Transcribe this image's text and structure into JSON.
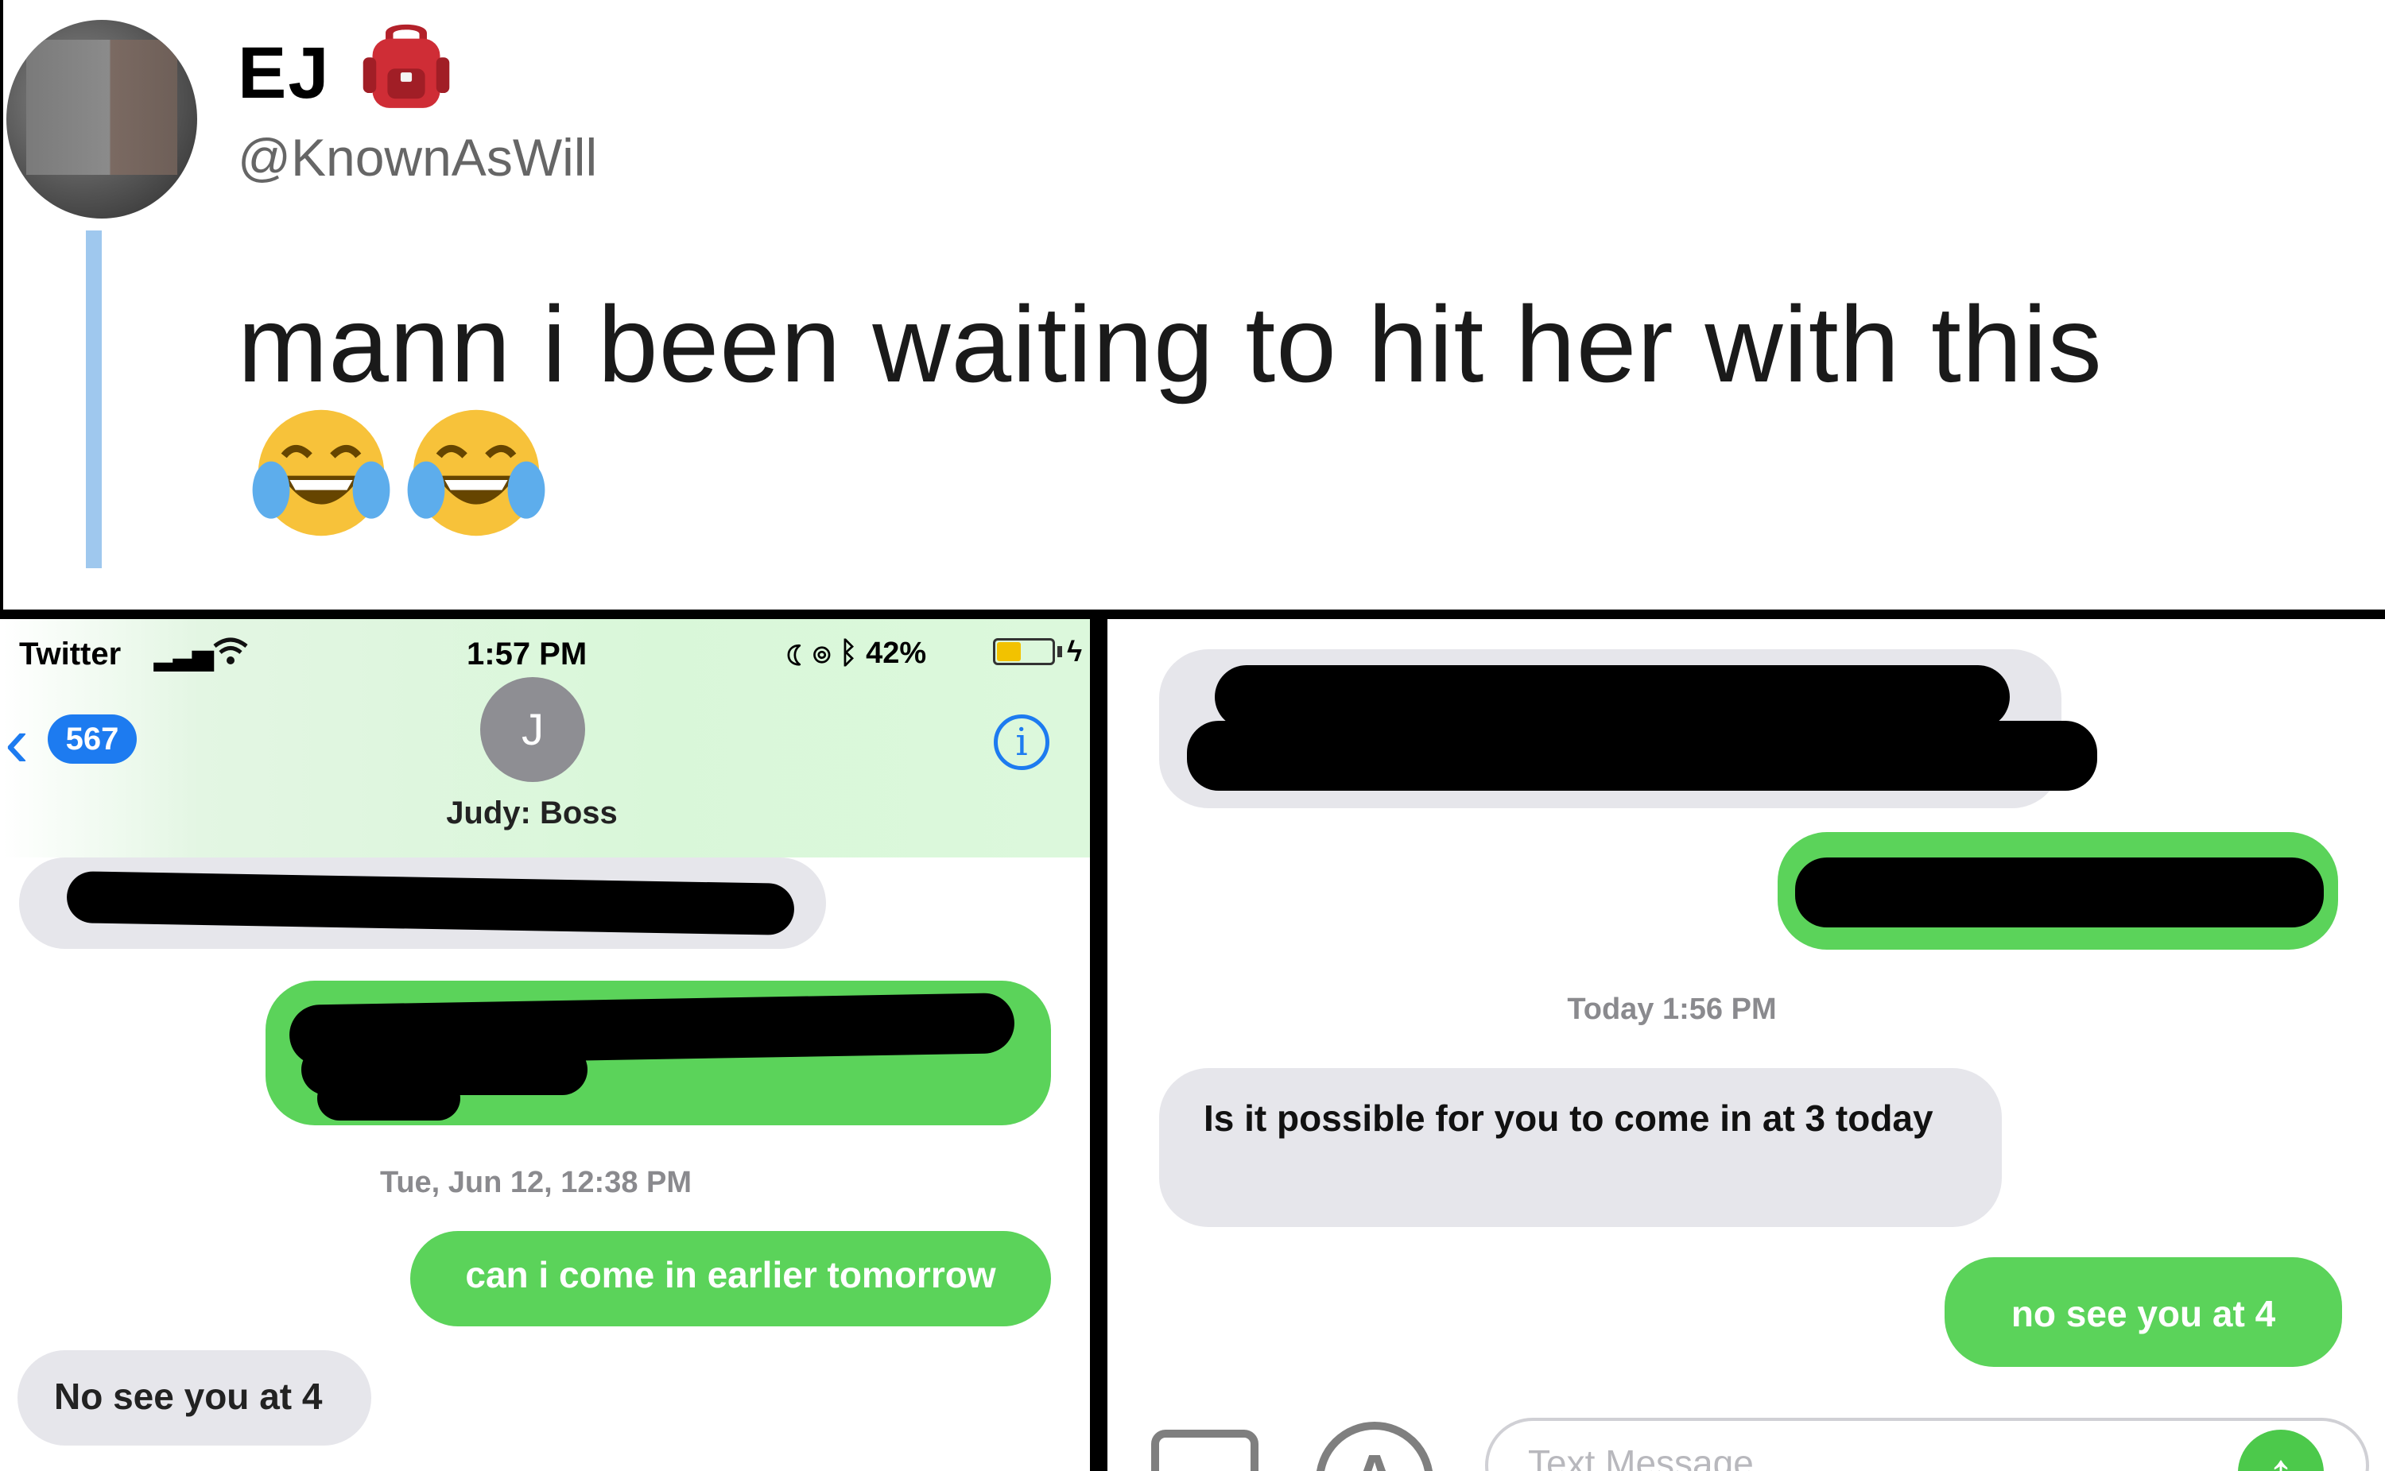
{
  "tweet": {
    "display_name": "EJ",
    "name_emoji": "backpack-emoji",
    "handle": "@KnownAsWill",
    "text": "mann i been waiting to hit her with this",
    "text_emojis": [
      "face-with-tears-of-joy",
      "face-with-tears-of-joy"
    ]
  },
  "left_screenshot": {
    "status_bar": {
      "carrier": "Twitter",
      "time": "1:57 PM",
      "battery_percent": "42%"
    },
    "back_badge": "567",
    "contact_initial": "J",
    "contact_name": "Judy: Boss",
    "messages": [
      {
        "from": "them",
        "text": "",
        "redacted": true
      },
      {
        "from": "me",
        "text": "",
        "redacted": true
      },
      {
        "type": "timestamp",
        "text": "Tue, Jun 12, 12:38 PM"
      },
      {
        "from": "me",
        "text": "can i come in earlier tomorrow"
      },
      {
        "from": "them",
        "text": "No see you at 4"
      }
    ]
  },
  "right_screenshot": {
    "messages": [
      {
        "from": "them",
        "text": "",
        "redacted": true
      },
      {
        "from": "me",
        "text": "",
        "redacted": true
      },
      {
        "type": "timestamp",
        "text": "Today 1:56 PM"
      },
      {
        "from": "them",
        "text": "Is it possible for you to come in at 3 today"
      },
      {
        "from": "me",
        "text": "no see you at 4"
      }
    ],
    "input_placeholder": "Text Message"
  },
  "colors": {
    "imessage_green": "#5bd35a",
    "imessage_gray": "#e6e6eb",
    "ios_blue": "#1d7bf0",
    "thread_line": "#9fc8ee"
  }
}
